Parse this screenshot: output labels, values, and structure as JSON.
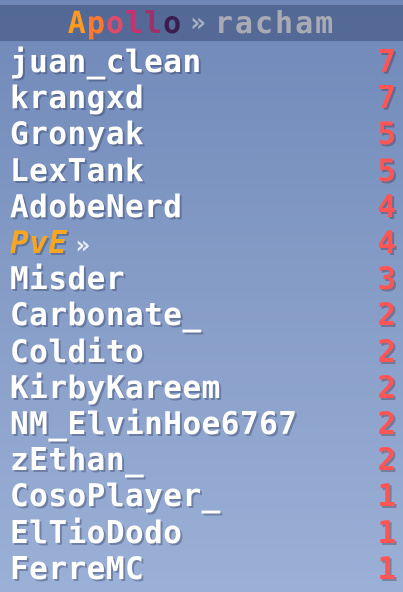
{
  "header": {
    "title_chars": [
      {
        "ch": "A",
        "color": "#ff9a1f"
      },
      {
        "ch": "p",
        "color": "#ff7a2e"
      },
      {
        "ch": "o",
        "color": "#e04a6a"
      },
      {
        "ch": "l",
        "color": "#c8306e"
      },
      {
        "ch": "l",
        "color": "#a0306a"
      },
      {
        "ch": "o",
        "color": "#3a1c50"
      }
    ],
    "separator": "»",
    "server": "racham"
  },
  "rows": [
    {
      "name": "juan_clean",
      "score": "7"
    },
    {
      "name": "krangxd",
      "score": "7"
    },
    {
      "name": "Gronyak",
      "score": "5"
    },
    {
      "name": "LexTank",
      "score": "5"
    },
    {
      "name": "AdobeNerd",
      "score": "4"
    },
    {
      "name": "PvE",
      "score": "4",
      "special": true,
      "arrow": "»"
    },
    {
      "name": "Misder",
      "score": "3"
    },
    {
      "name": "Carbonate_",
      "score": "2"
    },
    {
      "name": "Coldito",
      "score": "2"
    },
    {
      "name": "KirbyKareem",
      "score": "2"
    },
    {
      "name": "NM_ElvinHoe6767",
      "score": "2"
    },
    {
      "name": "zEthan_",
      "score": "2"
    },
    {
      "name": "CosoPlayer_",
      "score": "1"
    },
    {
      "name": "ElTioDodo",
      "score": "1"
    },
    {
      "name": "FerreMC",
      "score": "1"
    }
  ],
  "colors": {
    "score": "#ff5555",
    "name": "#ffffff",
    "special_name": "#f5a623"
  }
}
